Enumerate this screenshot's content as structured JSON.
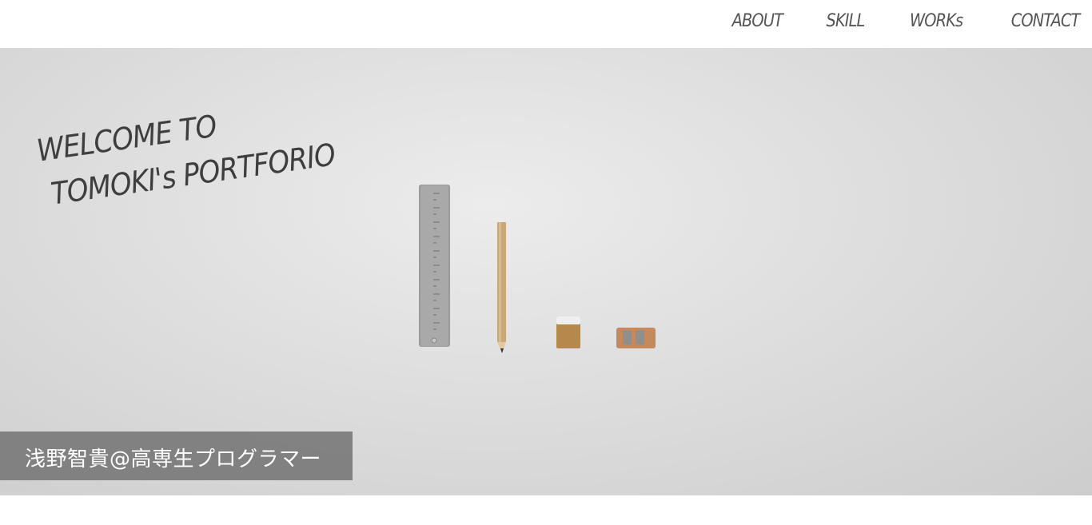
{
  "nav": {
    "items": [
      {
        "label": "ABOUT"
      },
      {
        "label": "SKILL"
      },
      {
        "label": "WORKs"
      },
      {
        "label": "CONTACT"
      }
    ]
  },
  "hero": {
    "title_line1": "WELCOME TO",
    "title_line2": "TOMOKI's PORTFORIO",
    "subtitle": "浅野智貴@高専生プログラマー",
    "props": [
      "ruler",
      "pencil",
      "eraser",
      "pencil-sharpener"
    ]
  },
  "colors": {
    "header_bg": "#ffffff",
    "nav_text": "#555555",
    "hero_bg": "#dedede",
    "title_text": "#3e3e3e",
    "subtitle_bar": "#787878",
    "subtitle_text": "#ffffff"
  }
}
